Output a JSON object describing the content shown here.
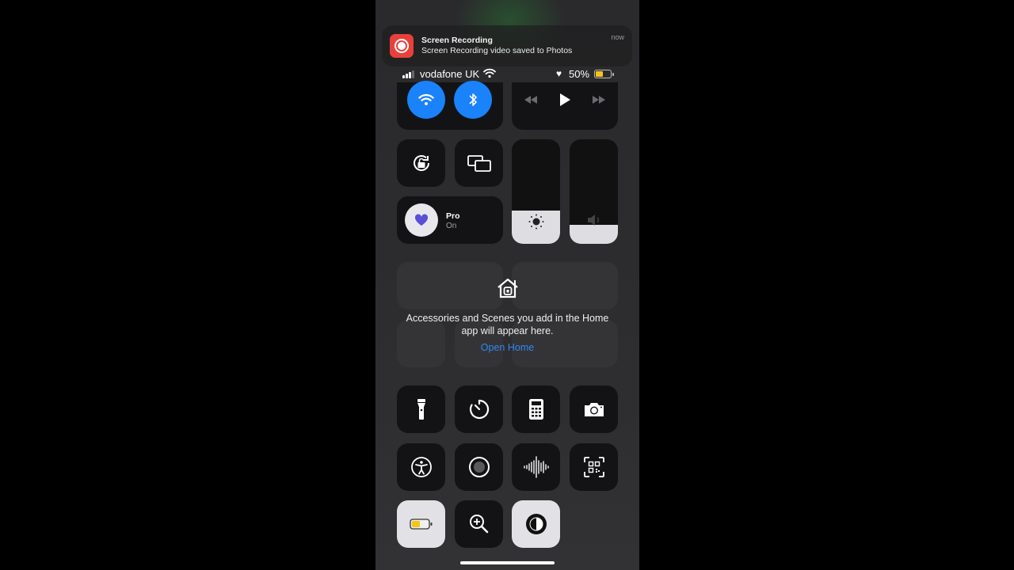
{
  "notification": {
    "app": "Screen Recording",
    "title": "Screen Recording",
    "body": "Screen Recording video saved to Photos",
    "time": "now",
    "icon": "screen-recording-icon",
    "icon_color": "#e8403a"
  },
  "status_bar": {
    "carrier": "vodafone UK",
    "signal_bars": 3,
    "wifi": true,
    "heart": "♥",
    "battery_percent": "50%",
    "battery_level": 0.5,
    "battery_color": "#f5c518"
  },
  "connectivity": {
    "wifi_icon": "wifi-icon",
    "bluetooth_icon": "bluetooth-icon",
    "active_color": "#1a82fb"
  },
  "media": {
    "rewind_icon": "rewind-icon",
    "play_icon": "play-icon",
    "forward_icon": "fast-forward-icon"
  },
  "controls": {
    "rotation_lock_icon": "rotation-lock-icon",
    "screen_mirroring_icon": "screen-mirroring-icon",
    "focus": {
      "label": "Pro",
      "status": "On",
      "icon": "heart-icon",
      "icon_color": "#5a4fd6"
    }
  },
  "sliders": {
    "brightness": {
      "icon": "sun-icon",
      "level": 0.32
    },
    "volume": {
      "icon": "speaker-icon",
      "level": 0.18
    }
  },
  "home": {
    "icon": "home-icon",
    "message": "Accessories and Scenes you add in the Home app will appear here.",
    "message_line1": "Accessories and Scenes you add in the Home",
    "message_line2": "app will appear here.",
    "link": "Open Home",
    "link_color": "#2f86f6"
  },
  "shortcuts": [
    {
      "name": "flashlight",
      "icon": "flashlight-icon"
    },
    {
      "name": "timer",
      "icon": "timer-icon"
    },
    {
      "name": "calculator",
      "icon": "calculator-icon"
    },
    {
      "name": "camera",
      "icon": "camera-icon"
    },
    {
      "name": "accessibility",
      "icon": "accessibility-icon"
    },
    {
      "name": "screen-recording",
      "icon": "record-icon"
    },
    {
      "name": "voice-memos",
      "icon": "waveform-icon"
    },
    {
      "name": "code-scanner",
      "icon": "qr-code-icon"
    },
    {
      "name": "low-power-mode",
      "icon": "battery-icon",
      "active": true
    },
    {
      "name": "magnifier",
      "icon": "magnifier-icon"
    },
    {
      "name": "dark-mode",
      "icon": "dark-mode-icon",
      "active": true
    }
  ]
}
